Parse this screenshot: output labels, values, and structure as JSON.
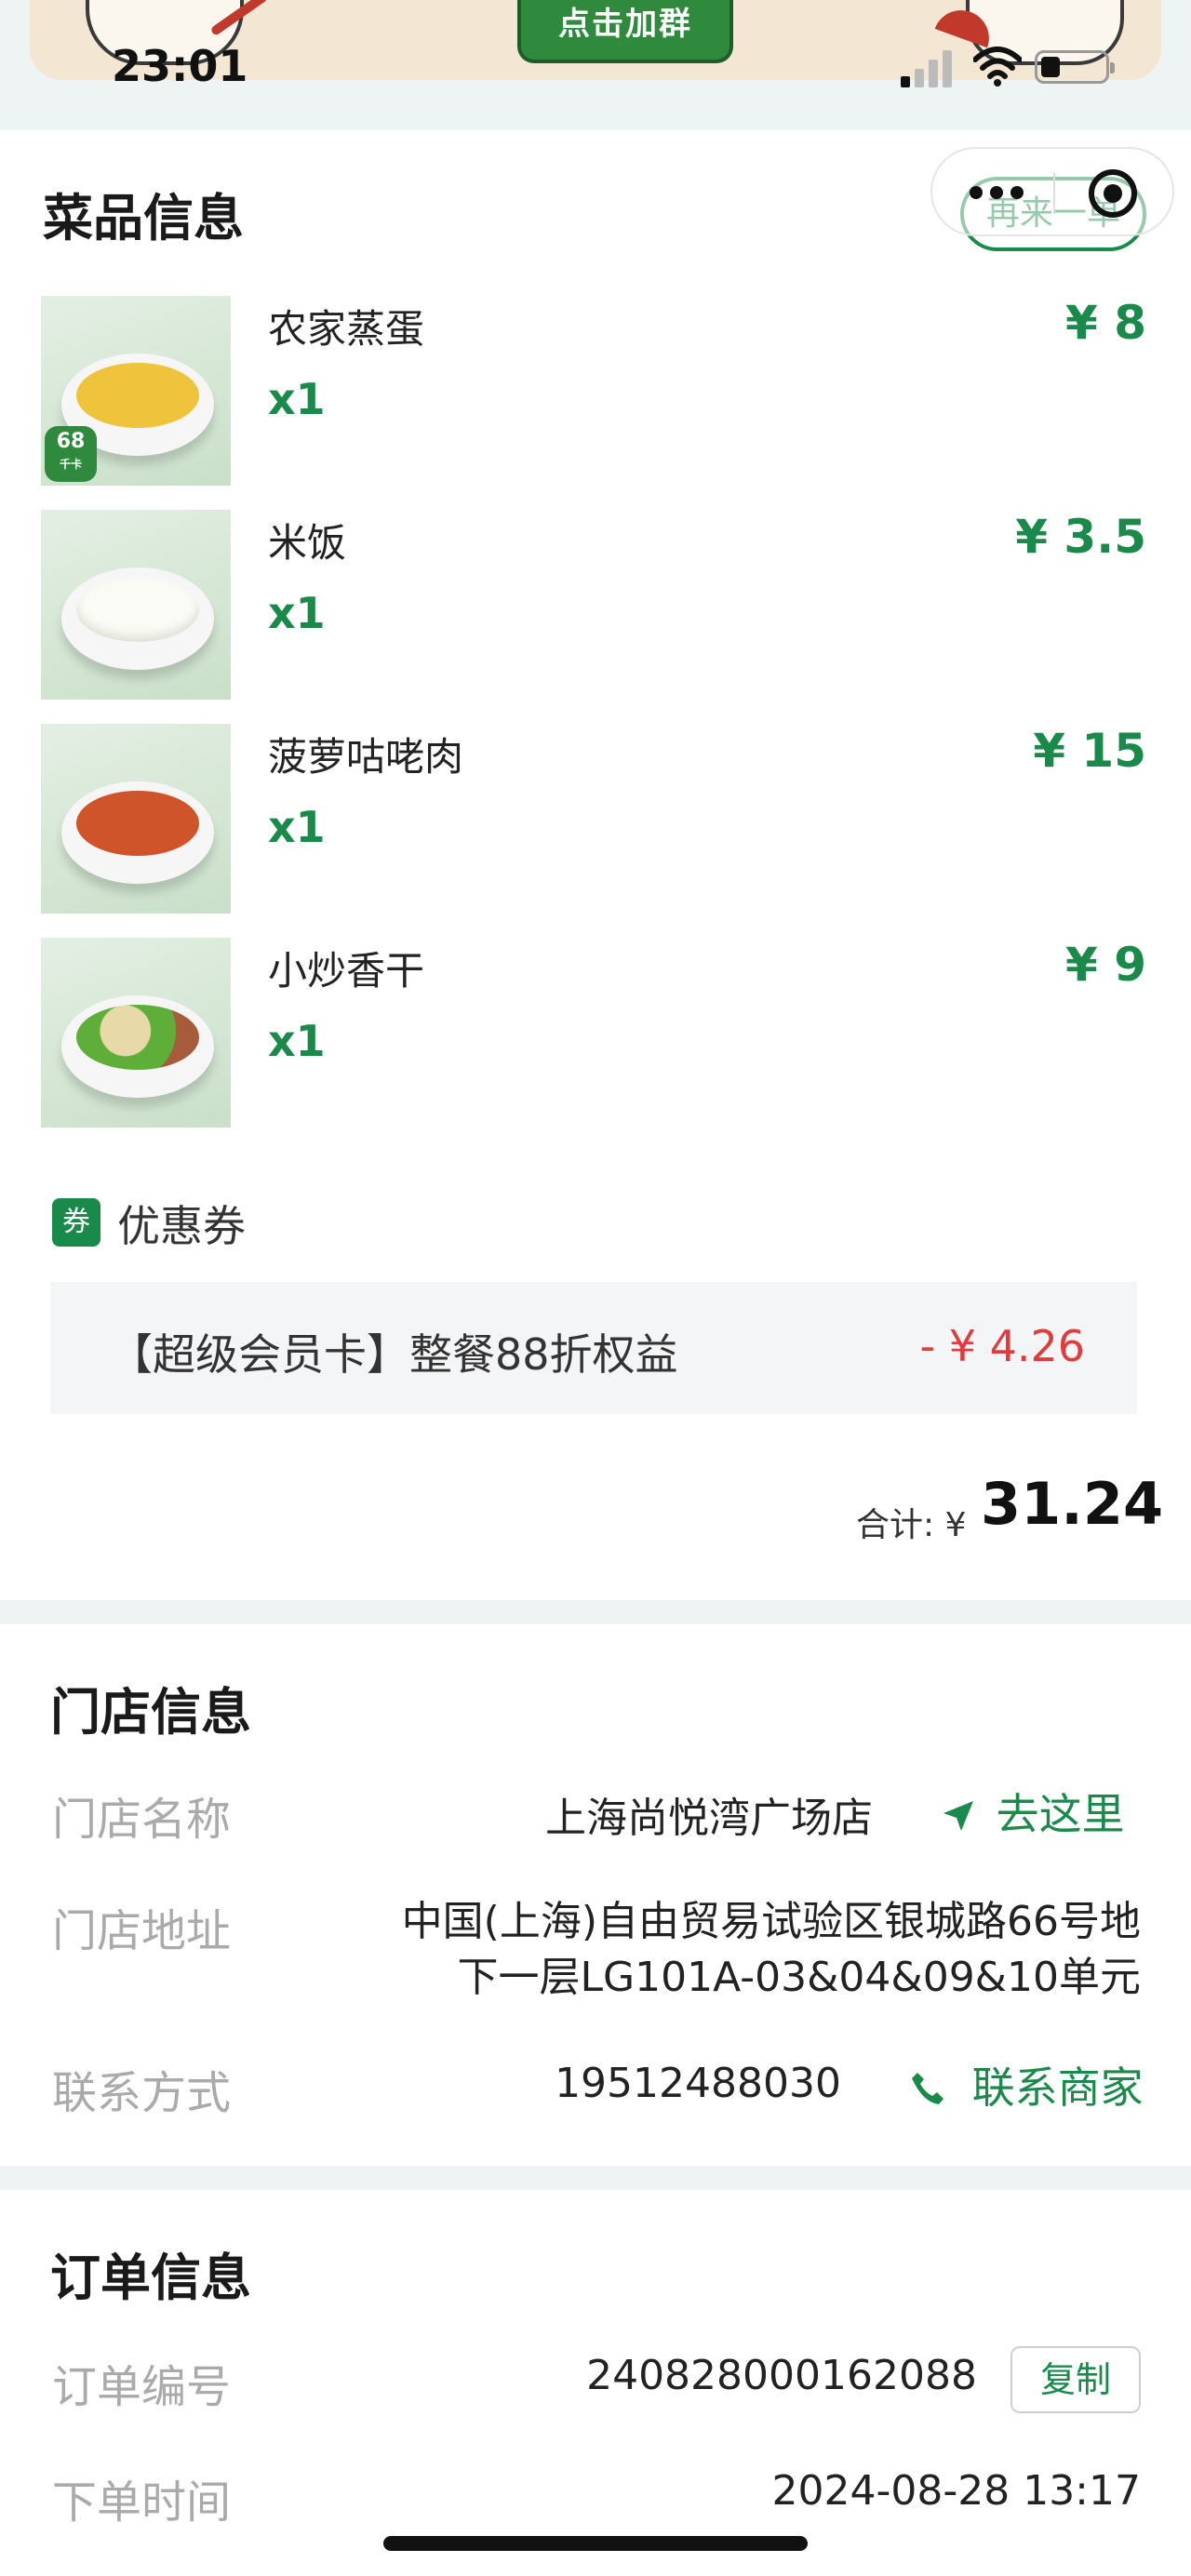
{
  "status_bar": {
    "time": "23:01"
  },
  "banner": {
    "join_label": "点击加群"
  },
  "dishes_section": {
    "title": "菜品信息",
    "reorder_label": "再来一单",
    "items": [
      {
        "name": "农家蒸蛋",
        "qty": "x1",
        "price": "¥ 8",
        "badge_value": "68",
        "badge_unit": "千卡"
      },
      {
        "name": "米饭",
        "qty": "x1",
        "price": "¥ 3.5"
      },
      {
        "name": "菠萝咕咾肉",
        "qty": "x1",
        "price": "¥ 15"
      },
      {
        "name": "小炒香干",
        "qty": "x1",
        "price": "¥ 9"
      }
    ],
    "coupon": {
      "icon_char": "券",
      "label": "优惠券",
      "name": "【超级会员卡】整餐88折权益",
      "amount": "- ¥ 4.26"
    },
    "total": {
      "label": "合计: ¥",
      "value": "31.24"
    }
  },
  "store_section": {
    "title": "门店信息",
    "name_label": "门店名称",
    "name_value": "上海尚悦湾广场店",
    "navigate_label": "去这里",
    "address_label": "门店地址",
    "address_line1": "中国(上海)自由贸易试验区银城路66号地",
    "address_line2": "下一层LG101A-03&04&09&10单元",
    "contact_label": "联系方式",
    "contact_value": "19512488030",
    "call_label": "联系商家"
  },
  "order_section": {
    "title": "订单信息",
    "number_label": "订单编号",
    "number_value": "240828000162088",
    "copy_label": "复制",
    "time_label": "下单时间",
    "time_value": "2024-08-28 13:17"
  },
  "colors": {
    "accent": "#1a8a4a",
    "discount": "#e23b3b",
    "label_gray": "#aaaaaa"
  }
}
